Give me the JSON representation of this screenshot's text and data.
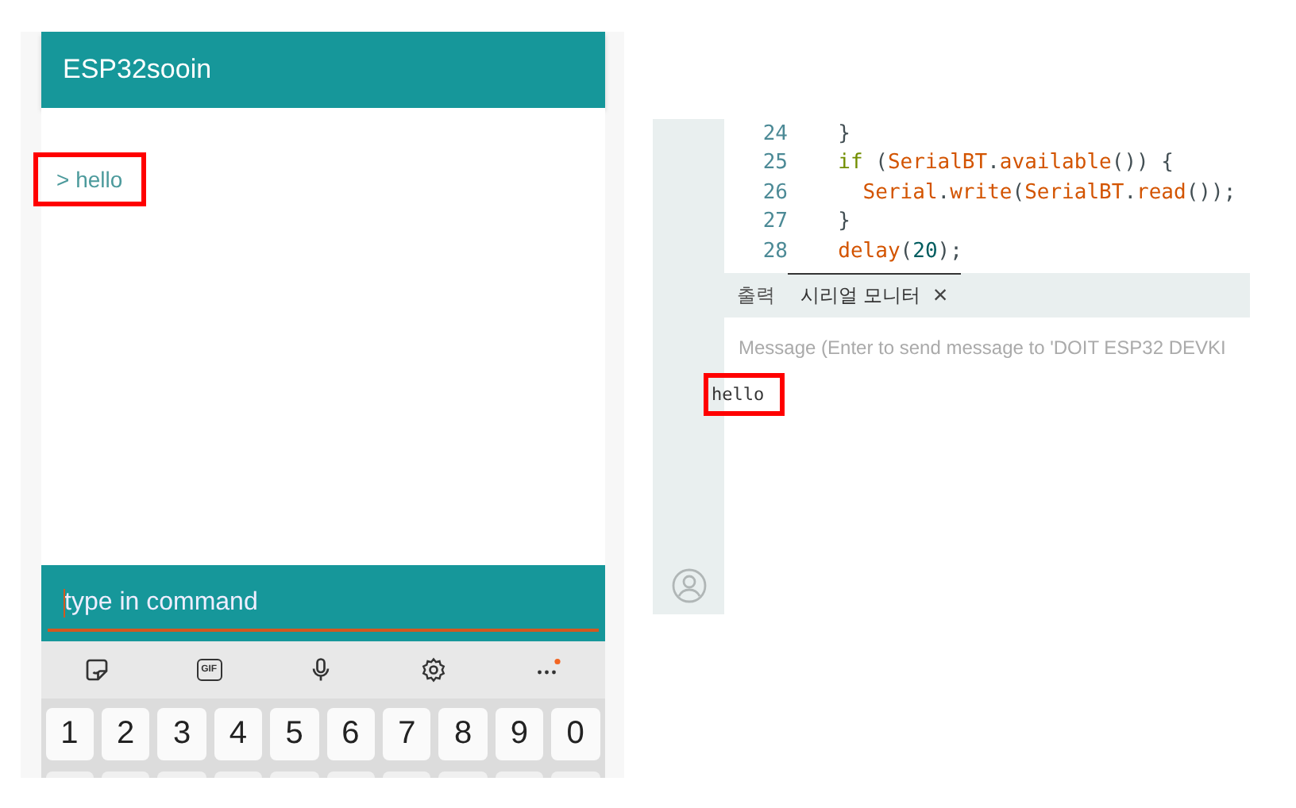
{
  "phone_app": {
    "title": "ESP32sooin",
    "messages": [
      {
        "text": "> hello",
        "highlighted": true
      }
    ],
    "command_field": {
      "placeholder": "type in command"
    }
  },
  "keyboard": {
    "gif_label": "GIF",
    "more_badge": true,
    "keys": [
      "1",
      "2",
      "3",
      "4",
      "5",
      "6",
      "7",
      "8",
      "9",
      "0"
    ]
  },
  "ide": {
    "code_lines": [
      {
        "number": "24",
        "tokens": [
          {
            "text": "  }",
            "kind": "plain"
          }
        ]
      },
      {
        "number": "25",
        "tokens": [
          {
            "text": "  if",
            "kind": "keyword"
          },
          {
            "text": " (",
            "kind": "plain"
          },
          {
            "text": "SerialBT",
            "kind": "name"
          },
          {
            "text": ".",
            "kind": "plain"
          },
          {
            "text": "available",
            "kind": "name"
          },
          {
            "text": "()) {",
            "kind": "plain"
          }
        ]
      },
      {
        "number": "26",
        "tokens": [
          {
            "text": "    Serial",
            "kind": "name"
          },
          {
            "text": ".",
            "kind": "plain"
          },
          {
            "text": "write",
            "kind": "name"
          },
          {
            "text": "(",
            "kind": "plain"
          },
          {
            "text": "SerialBT",
            "kind": "name"
          },
          {
            "text": ".",
            "kind": "plain"
          },
          {
            "text": "read",
            "kind": "name"
          },
          {
            "text": "());",
            "kind": "plain"
          }
        ]
      },
      {
        "number": "27",
        "tokens": [
          {
            "text": "  }",
            "kind": "plain"
          }
        ]
      },
      {
        "number": "28",
        "tokens": [
          {
            "text": "  delay",
            "kind": "name"
          },
          {
            "text": "(",
            "kind": "plain"
          },
          {
            "text": "20",
            "kind": "number"
          },
          {
            "text": ");",
            "kind": "plain"
          }
        ]
      }
    ],
    "tabs": [
      {
        "label": "출력",
        "selected": false,
        "closable": false
      },
      {
        "label": "시리얼 모니터",
        "selected": true,
        "closable": true
      }
    ],
    "close_glyph": "×",
    "message_field": {
      "placeholder": "Message (Enter to send message to 'DOIT ESP32 DEVKI"
    },
    "output": [
      {
        "text": "hello",
        "highlighted": true
      }
    ]
  }
}
